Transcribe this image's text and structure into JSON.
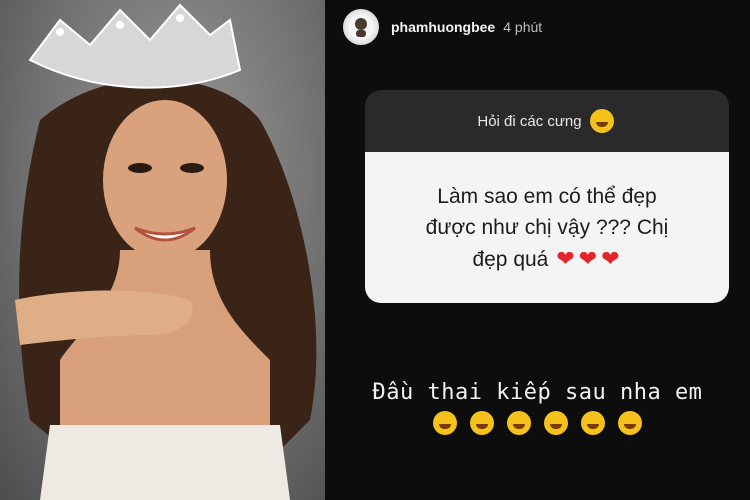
{
  "story": {
    "username": "phamhuongbee",
    "time": "4 phút",
    "question_prompt": "Hỏi đi các cưng",
    "question_text": "Làm sao em có thể đẹp được như chị vậy ??? Chị đẹp quá",
    "answer_text": "Đầu thai kiếp sau nha em",
    "prompt_emoji": "laughing-face",
    "question_hearts": 3,
    "answer_emojis": 6
  },
  "colors": {
    "story_bg": "#0d0d0d",
    "question_header_bg": "#2a2a2a",
    "question_body_bg": "#f4f4f4",
    "heart": "#e3262a"
  }
}
